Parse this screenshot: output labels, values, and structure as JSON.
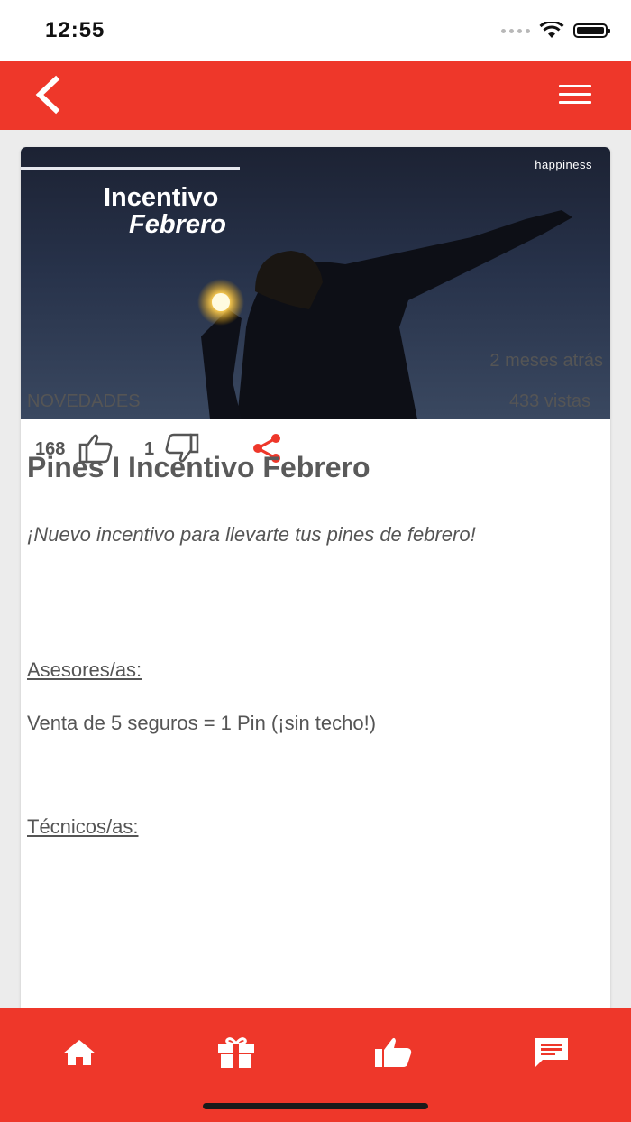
{
  "status_bar": {
    "time": "12:55"
  },
  "colors": {
    "brand_red": "#ee372a",
    "text_gray": "#555555"
  },
  "header": {
    "back_icon": "chevron-left-icon",
    "menu_icon": "hamburger-menu-icon"
  },
  "post": {
    "banner": {
      "title_line1": "Incentivo",
      "title_line2": "Febrero",
      "logo": "happiness"
    },
    "likes": "168",
    "dislikes": "1",
    "time_ago": "2 meses atrás",
    "category": "NOVEDADES",
    "views": "433 vistas",
    "title": "Pines I Incentivo Febrero",
    "intro": "¡Nuevo incentivo para llevarte tus pines de febrero!",
    "sections": [
      {
        "heading": "Asesores/as:",
        "text": "Venta de 5 seguros = 1 Pin (¡sin techo!)"
      },
      {
        "heading": "Técnicos/as:"
      }
    ]
  },
  "bottom_nav": {
    "items": [
      {
        "icon": "home-icon"
      },
      {
        "icon": "gift-icon"
      },
      {
        "icon": "thumbs-up-icon"
      },
      {
        "icon": "chat-icon"
      }
    ]
  }
}
